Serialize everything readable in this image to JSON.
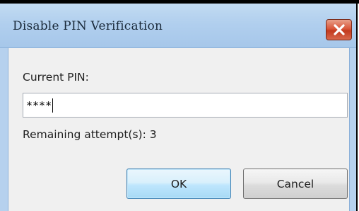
{
  "dialog": {
    "title": "Disable PIN Verification",
    "close_icon": "close-x-icon"
  },
  "form": {
    "pin_label": "Current PIN:",
    "pin_value": "****",
    "remaining_label": "Remaining attempt(s): 3"
  },
  "buttons": {
    "ok_label": "OK",
    "cancel_label": "Cancel"
  },
  "colors": {
    "titlebar": "#b1cfee",
    "close_button": "#d9573a",
    "ok_button_accent": "#bee6fd"
  }
}
